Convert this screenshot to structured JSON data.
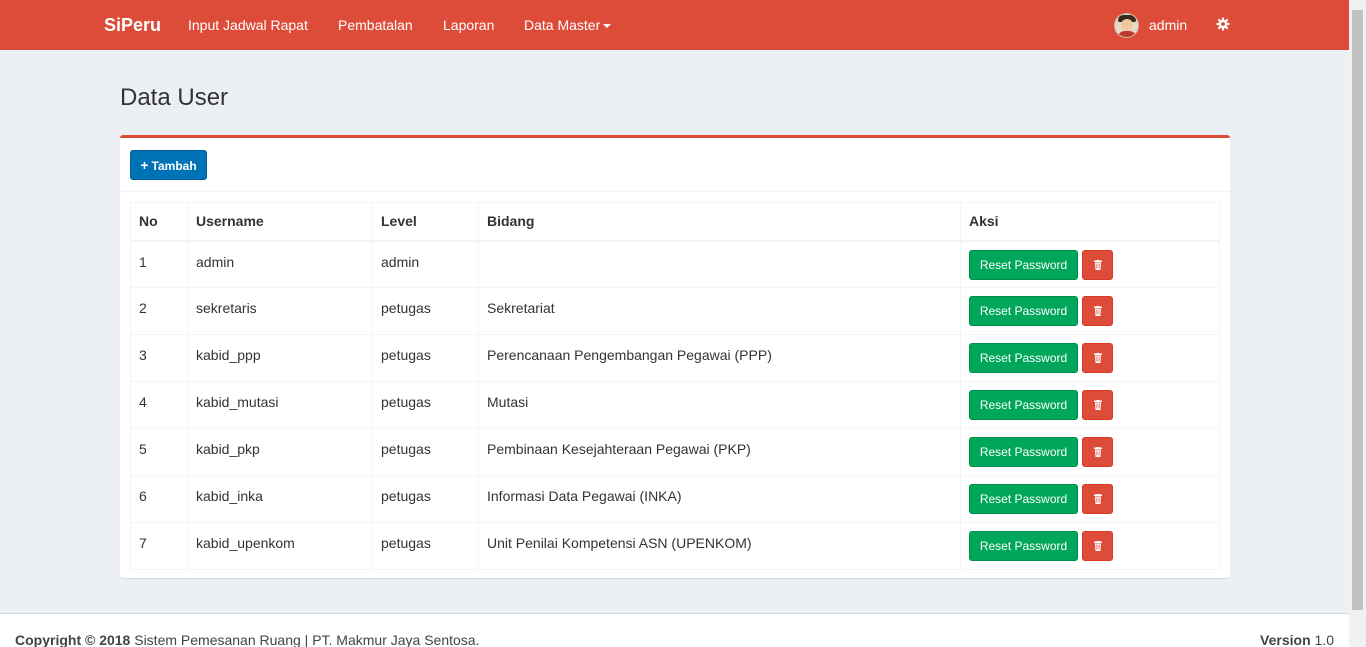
{
  "navbar": {
    "brand": "SiPeru",
    "links": [
      "Input Jadwal Rapat",
      "Pembatalan",
      "Laporan",
      "Data Master"
    ],
    "user": "admin",
    "color": "#dd4b39"
  },
  "page": {
    "title": "Data User"
  },
  "toolbar": {
    "add_label": "Tambah"
  },
  "table": {
    "headers": [
      "No",
      "Username",
      "Level",
      "Bidang",
      "Aksi"
    ],
    "rows": [
      {
        "no": "1",
        "username": "admin",
        "level": "admin",
        "bidang": ""
      },
      {
        "no": "2",
        "username": "sekretaris",
        "level": "petugas",
        "bidang": "Sekretariat"
      },
      {
        "no": "3",
        "username": "kabid_ppp",
        "level": "petugas",
        "bidang": "Perencanaan Pengembangan Pegawai (PPP)"
      },
      {
        "no": "4",
        "username": "kabid_mutasi",
        "level": "petugas",
        "bidang": "Mutasi"
      },
      {
        "no": "5",
        "username": "kabid_pkp",
        "level": "petugas",
        "bidang": "Pembinaan Kesejahteraan Pegawai (PKP)"
      },
      {
        "no": "6",
        "username": "kabid_inka",
        "level": "petugas",
        "bidang": "Informasi Data Pegawai (INKA)"
      },
      {
        "no": "7",
        "username": "kabid_upenkom",
        "level": "petugas",
        "bidang": "Unit Penilai Kompetensi ASN (UPENKOM)"
      }
    ],
    "reset_label": "Reset Password"
  },
  "footer": {
    "copyright_bold": "Copyright © 2018",
    "copyright_text": "Sistem Pemesanan Ruang | PT. Makmur Jaya Sentosa.",
    "version_label": "Version",
    "version_value": "1.0"
  }
}
